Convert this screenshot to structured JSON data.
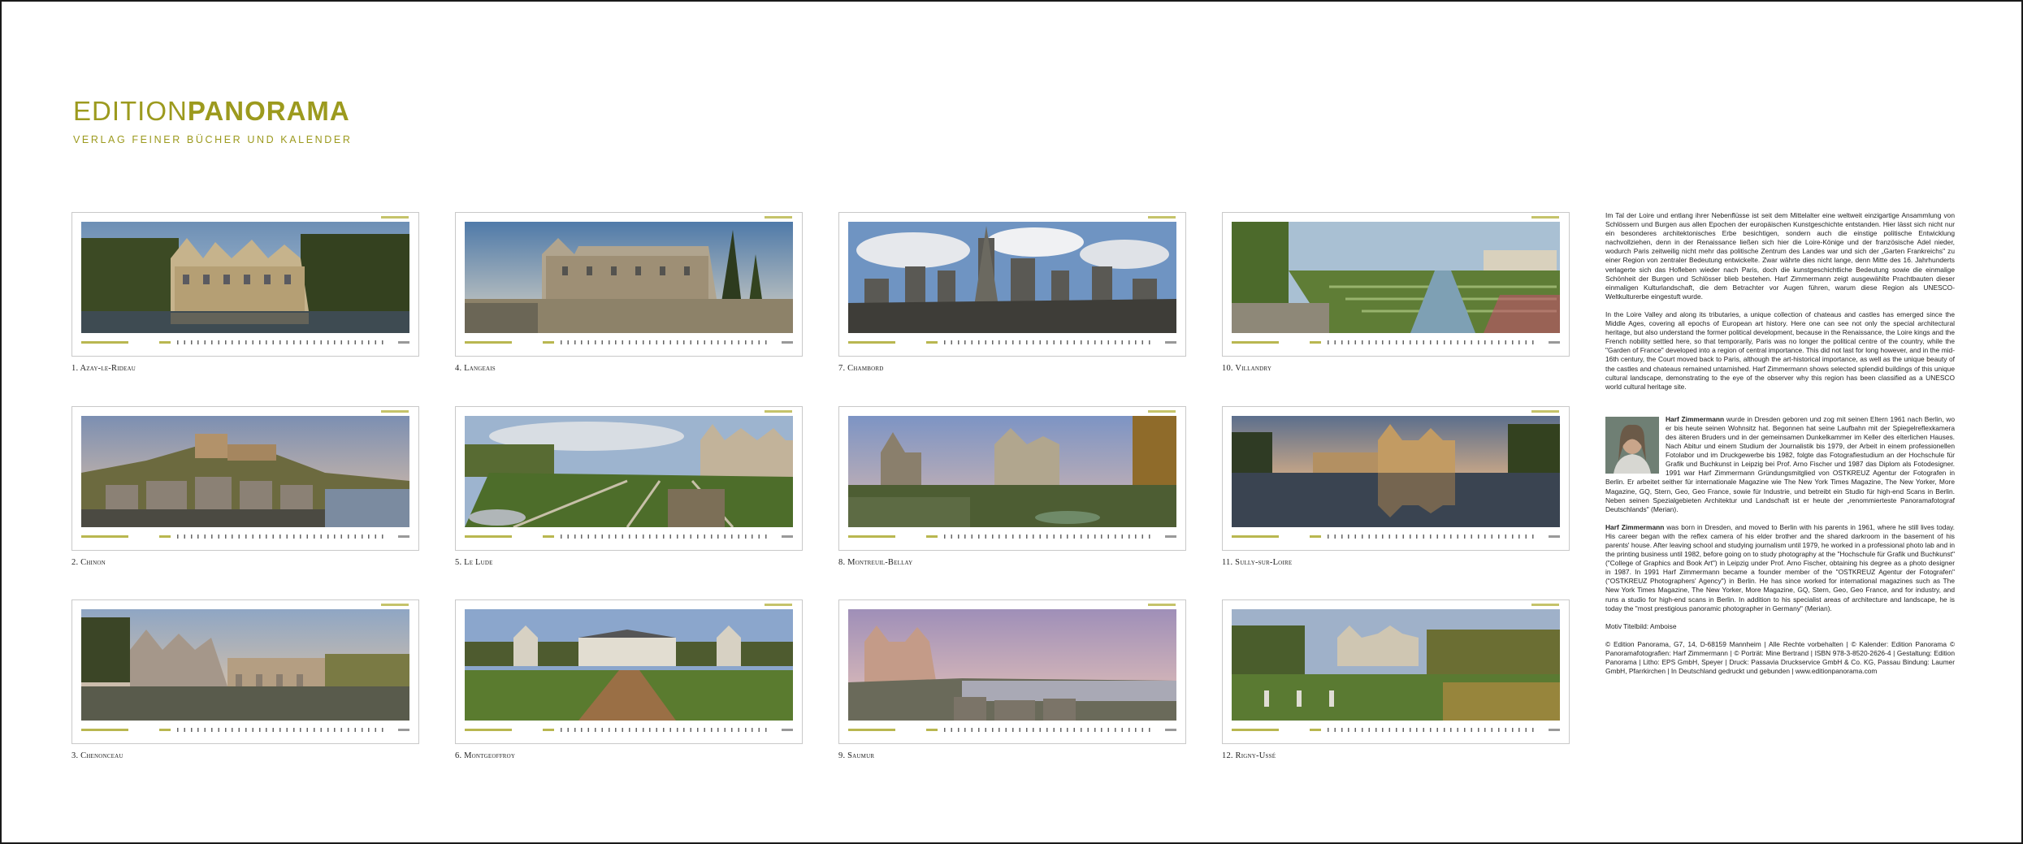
{
  "brand": {
    "title_light": "EDITION",
    "title_bold": "PANORAMA",
    "subtitle": "VERLAG FEINER BÜCHER UND KALENDER",
    "color": "#9c9a1e"
  },
  "months": [
    {
      "caption": "1. Azay-le-Rideau"
    },
    {
      "caption": "4. Langeais"
    },
    {
      "caption": "7. Chambord"
    },
    {
      "caption": "10. Villandry"
    },
    {
      "caption": "2. Chinon"
    },
    {
      "caption": "5. Le Lude"
    },
    {
      "caption": "8. Montreuil-Bellay"
    },
    {
      "caption": "11. Sully-sur-Loire"
    },
    {
      "caption": "3. Chenonceau"
    },
    {
      "caption": "6. Montgeoffroy"
    },
    {
      "caption": "9. Saumur"
    },
    {
      "caption": "12. Rigny-Ussé"
    }
  ],
  "text": {
    "intro_de": "Im Tal der Loire und entlang ihrer Nebenflüsse ist seit dem Mittelalter eine weltweit einzigartige Ansammlung von Schlössern und Burgen aus allen Epochen der europäischen Kunstgeschichte entstanden. Hier lässt sich nicht nur ein besonderes architektonisches Erbe besichtigen, sondern auch die einstige politische Entwicklung nachvollziehen, denn in der Renaissance ließen sich hier die Loire-Könige und der französische Adel nieder, wodurch Paris zeitweilig nicht mehr das politische Zentrum des Landes war und sich der „Garten Frankreichs\" zu einer Region von zentraler Bedeutung entwickelte. Zwar währte dies nicht lange, denn Mitte des 16. Jahrhunderts verlagerte sich das Hofleben wieder nach Paris, doch die kunstgeschichtliche Bedeutung sowie die einmalige Schönheit der Burgen und Schlösser blieb bestehen. Harf Zimmermann zeigt ausgewählte Prachtbauten dieser einmaligen Kulturlandschaft, die dem Betrachter vor Augen führen, warum diese Region als UNESCO-Weltkulturerbe eingestuft wurde.",
    "intro_en": "In the Loire Valley and along its tributaries, a unique collection of chateaus and castles has emerged since the Middle Ages, covering all epochs of European art history. Here one can see not only the special architectural heritage, but also understand the former political development, because in the Renaissance, the Loire kings and the French nobility settled here, so that temporarily, Paris was no longer the political centre of the country, while the \"Garden of France\" developed into a region of central importance. This did not last for long however, and in the mid-16th century, the Court moved back to Paris, although the art-historical importance, as well as the unique beauty of the castles and chateaus remained untarnished. Harf Zimmermann shows selected splendid buildings of this unique cultural landscape, demonstrating to the eye of the observer why this region has been classified as a UNESCO world cultural heritage site.",
    "bio_de_name": "Harf Zimmermann",
    "bio_de": " wurde in Dresden geboren und zog mit seinen Eltern 1961 nach Berlin, wo er bis heute seinen Wohnsitz hat. Begonnen hat seine Laufbahn mit der Spiegelreflexkamera des älteren Bruders und in der gemeinsamen Dunkelkammer im Keller des elterlichen Hauses. Nach Abitur und einem Studium der Journalistik bis 1979, der Arbeit in einem professionellen Fotolabor und im Druckgewerbe bis 1982, folgte das Fotografiestudium an der Hochschule für Grafik und Buchkunst in Leipzig bei Prof. Arno Fischer und 1987 das Diplom als Fotodesigner. 1991 war Harf Zimmermann Gründungsmitglied von OSTKREUZ Agentur der Fotografen in Berlin. Er arbeitet seither für internationale Magazine wie The New York Times Magazine, The New Yorker, More Magazine, GQ, Stern, Geo, Geo France, sowie für Industrie, und betreibt ein Studio für high-end Scans in Berlin. Neben seinen Spezialgebieten Architektur und Landschaft ist er heute der „renommierteste Panoramafotograf Deutschlands\" (Merian).",
    "bio_en_name": "Harf Zimmermann",
    "bio_en": " was born in Dresden, and moved to Berlin with his parents in 1961, where he still lives today. His career began with the reflex camera of his elder brother and the shared darkroom in the basement of his parents' house. After leaving school and studying journalism until 1979, he worked in a professional photo lab and in the printing business until 1982, before going on to study photography at the \"Hochschule für Grafik und Buchkunst\" (\"College of Graphics and Book Art\") in Leipzig under Prof. Arno Fischer, obtaining his degree as a photo designer in 1987. In 1991 Harf Zimmermann became a founder member of the \"OSTKREUZ Agentur der Fotografen\" (\"OSTKREUZ Photographers' Agency\") in Berlin. He has since worked for international magazines such as The New York Times Magazine, The New Yorker, More Magazine, GQ, Stern, Geo, Geo France, and for industry, and runs a studio for high-end scans in Berlin. In addition to his specialist areas of architecture and landscape, he is today the \"most prestigious panoramic photographer in Germany\" (Merian).",
    "motif": "Motiv Titelbild: Amboise",
    "imprint": "© Edition Panorama, G7, 14, D-68159 Mannheim | Alle Rechte vorbehalten | © Kalender: Edition Panorama © Panoramafotografien: Harf Zimmermann | © Porträt: Mine Bertrand | ISBN 978-3-8520-2626-4 | Gestaltung: Edition Panorama | Litho: EPS GmbH, Speyer | Druck: Passavia Druckservice GmbH & Co. KG, Passau Bindung: Laumer GmbH, Pfarrkirchen | In Deutschland gedruckt und gebunden | www.editionpanorama.com"
  }
}
